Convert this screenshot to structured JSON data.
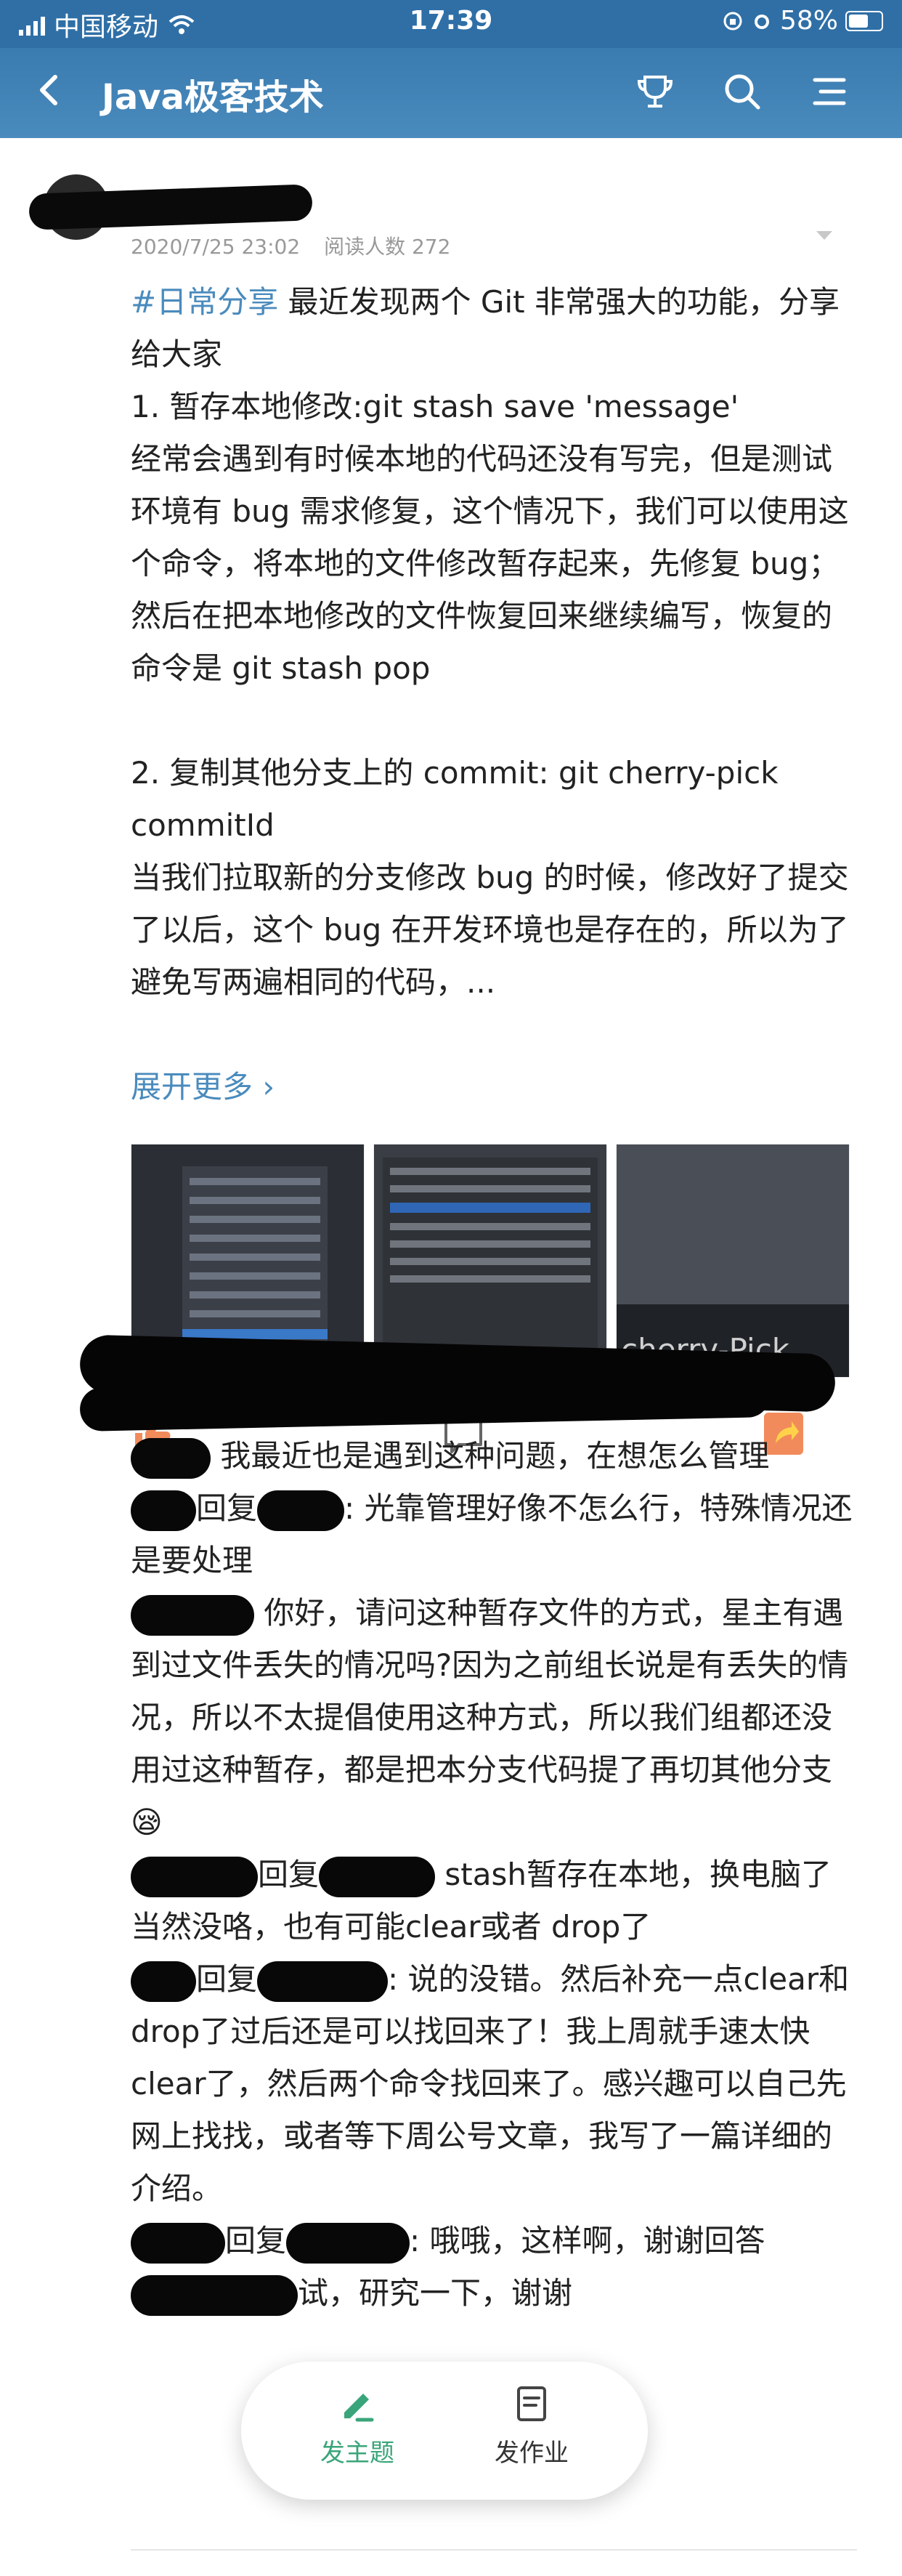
{
  "status_bar": {
    "carrier": "中国移动",
    "time": "17:39",
    "battery": "58%"
  },
  "app_bar": {
    "title": "Java极客技术"
  },
  "post": {
    "date": "2020/7/25 23:02",
    "read_count": "阅读人数 272",
    "lines": [
      "#日常分享 最近发现两个 Git 非常强大的功能，分享给大家",
      "1. 暂存本地修改:git stash save 'message'",
      "经常会遇到有时候本地的代码还没有写完，但是测试环境有 bug 需求修复，这个情况下，我们可以使用这个命令，将本地的文件修改暂存起来，先修复 bug；然后在把本地修改的文件恢复回来继续编写，恢复的命令是 git stash pop",
      "",
      "2. 复制其他分支上的 commit: git cherry-pick commitId",
      "当我们拉取新的分支修改 bug 的时候，修改好了提交了以后，这个 bug 在开发环境也是存在的，所以为了避免写两遍相同的代码，..."
    ],
    "tag": "#日常分享",
    "first_line_rest": " 最近发现两个 Git 非常强大的功能，分享给大家",
    "expand": "展开更多 ›",
    "thumb3_text": "cherry-Pick"
  },
  "comments": [
    {
      "text": " 我最近也是遇到这种问题，在想怎么管理"
    },
    {
      "reply": "回复",
      "text": ": 光靠管理好像不怎么行，特殊情况还是要处理"
    },
    {
      "text": " 你好，请问这种暂存文件的方式，星主有遇到过文件丢失的情况吗?因为之前组长说是有丢失的情况，所以不太提倡使用这种方式，所以我们组都还没用过这种暂存，都是把本分支代码提了再切其他分支😪"
    },
    {
      "reply": "回复",
      "text": " stash暂存在本地，换电脑了当然没咯，也有可能clear或者 drop了"
    },
    {
      "reply": "回复",
      "text": ": 说的没错。然后补充一点clear和drop了过后还是可以找回来了！我上周就手速太快clear了，然后两个命令找回来了。感兴趣可以自己先网上找找，或者等下周公号文章，我写了一篇详细的介绍。"
    },
    {
      "reply": "回复",
      "text": ": 哦哦，这样啊，谢谢回答"
    },
    {
      "text": "试，研究一下，谢谢"
    }
  ],
  "bottom_bar": {
    "post_topic": "发主题",
    "post_homework": "发作业"
  },
  "colors": {
    "accent": "#4a8bbd",
    "fab_active": "#3aa57a",
    "share_orange": "#f28b5b"
  }
}
